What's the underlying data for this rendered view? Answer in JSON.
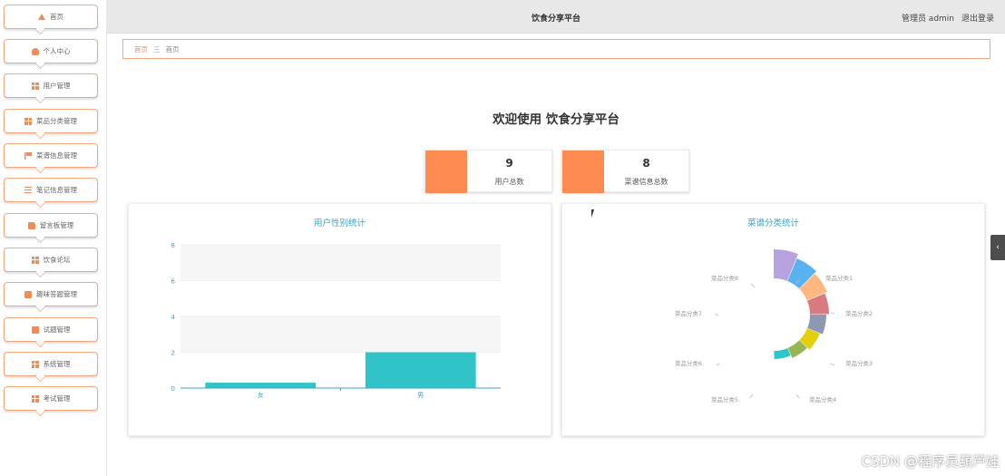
{
  "sidebar": {
    "items": [
      {
        "label": "首页",
        "icon": "home-icon"
      },
      {
        "label": "个人中心",
        "icon": "user-icon"
      },
      {
        "label": "用户管理",
        "icon": "grid-icon"
      },
      {
        "label": "菜品分类管理",
        "icon": "grid-icon"
      },
      {
        "label": "菜谱信息管理",
        "icon": "flag-icon"
      },
      {
        "label": "笔记信息管理",
        "icon": "list-icon"
      },
      {
        "label": "留言板管理",
        "icon": "thumb-icon"
      },
      {
        "label": "饮食论坛",
        "icon": "grid-icon"
      },
      {
        "label": "趣味答题管理",
        "icon": "screen-icon"
      },
      {
        "label": "试题管理",
        "icon": "screen-icon"
      },
      {
        "label": "系统管理",
        "icon": "grid-icon"
      },
      {
        "label": "考试管理",
        "icon": "grid-icon"
      }
    ]
  },
  "header": {
    "title": "饮食分享平台",
    "admin_label": "管理员 admin",
    "logout_label": "退出登录"
  },
  "breadcrumb": {
    "home": "首页",
    "separator": "三",
    "current": "首页"
  },
  "welcome": "欢迎使用 饮食分享平台",
  "stats": [
    {
      "value": "9",
      "label": "用户总数",
      "color": "#fe8b52"
    },
    {
      "value": "8",
      "label": "菜谱信息总数",
      "color": "#fe8b52"
    }
  ],
  "chart_data": [
    {
      "type": "bar",
      "title": "用户性别统计",
      "categories": [
        "女",
        "男"
      ],
      "values": [
        0.3,
        2
      ],
      "y_ticks": [
        "0",
        "2",
        "4",
        "6",
        "8"
      ],
      "ylim": [
        0,
        8
      ],
      "bar_color": "#30c4c9"
    },
    {
      "type": "pie",
      "title": "菜谱分类统计",
      "categories": [
        "菜品分类1",
        "菜品分类2",
        "菜品分类3",
        "菜品分类4",
        "菜品分类5",
        "菜品分类6",
        "菜品分类7",
        "菜品分类8"
      ],
      "colors": [
        "#b6a2de",
        "#5ab1ef",
        "#ffb980",
        "#d87a80",
        "#8d98b3",
        "#e5cf0d",
        "#97b552",
        "#2ec7c9"
      ]
    }
  ],
  "toggle_glyph": "‹",
  "watermark": "CSDN @程序员葫芦娃"
}
